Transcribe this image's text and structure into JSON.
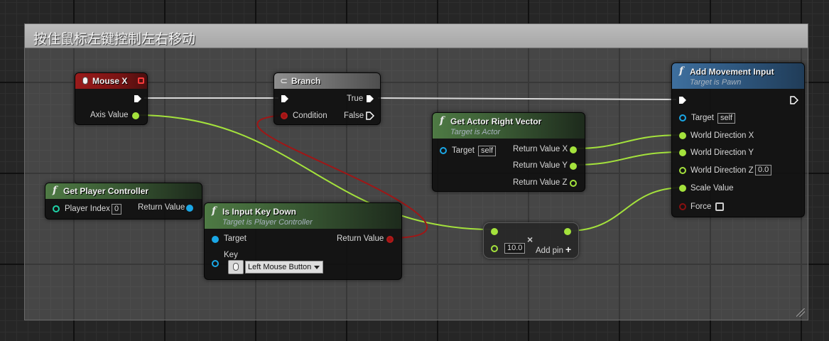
{
  "comment": {
    "title": "按住鼠标左键控制左右移动"
  },
  "nodes": {
    "mouse_x": {
      "title": "Mouse X",
      "axis_value": "Axis Value",
      "header_color": "#9a1b1b",
      "icon": "mouse-icon"
    },
    "branch": {
      "title": "Branch",
      "condition": "Condition",
      "true_label": "True",
      "false_label": "False",
      "icon": "branch-icon"
    },
    "get_actor_right_vector": {
      "title": "Get Actor Right Vector",
      "subtitle": "Target is Actor",
      "target": "Target",
      "target_default": "self",
      "return_x": "Return Value X",
      "return_y": "Return Value Y",
      "return_z": "Return Value Z"
    },
    "add_movement_input": {
      "title": "Add Movement Input",
      "subtitle": "Target is Pawn",
      "target": "Target",
      "target_default": "self",
      "world_direction_x": "World Direction X",
      "world_direction_y": "World Direction Y",
      "world_direction_z": "World Direction Z",
      "world_direction_z_default": "0.0",
      "scale_value": "Scale Value",
      "force": "Force",
      "header_color": "#3e6f9e"
    },
    "get_player_controller": {
      "title": "Get Player Controller",
      "player_index": "Player Index",
      "player_index_default": "0",
      "return_value": "Return Value"
    },
    "is_input_key_down": {
      "title": "Is Input Key Down",
      "subtitle": "Target is Player Controller",
      "target": "Target",
      "key": "Key",
      "key_value": "Left Mouse Button",
      "return_value": "Return Value"
    },
    "multiply": {
      "operator": "×",
      "b_default": "10.0",
      "add_pin": "Add pin",
      "add_pin_icon": "+"
    }
  },
  "colors": {
    "float_pin": "#a4e23c",
    "object_pin": "#1aa7e6",
    "bool_pin": "#a01414",
    "exec_wire": "#e0e0e0"
  }
}
